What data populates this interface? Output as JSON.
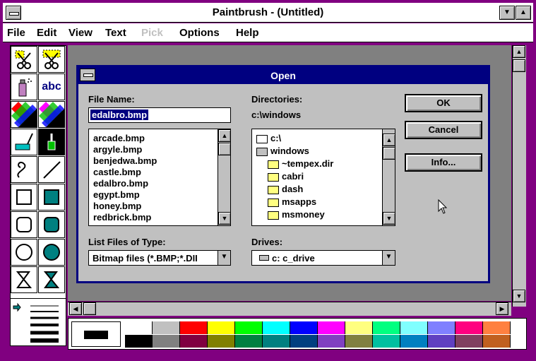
{
  "window": {
    "title": "Paintbrush - (Untitled)"
  },
  "menu": [
    "File",
    "Edit",
    "View",
    "Text",
    "Pick",
    "Options",
    "Help"
  ],
  "menu_disabled": [
    "Pick"
  ],
  "dialog": {
    "title": "Open",
    "file_name_label": "File Name:",
    "file_name_value": "edalbro.bmp",
    "directories_label": "Directories:",
    "current_dir": "c:\\windows",
    "files": [
      "arcade.bmp",
      "argyle.bmp",
      "benjedwa.bmp",
      "castle.bmp",
      "edalbro.bmp",
      "egypt.bmp",
      "honey.bmp",
      "redbrick.bmp"
    ],
    "dirs": [
      "c:\\",
      "windows",
      "~tempex.dir",
      "cabri",
      "dash",
      "msapps",
      "msmoney"
    ],
    "list_type_label": "List Files of Type:",
    "list_type_value": "Bitmap files (*.BMP;*.DII",
    "drives_label": "Drives:",
    "drive_value": "c: c_drive",
    "ok_label": "OK",
    "cancel_label": "Cancel",
    "info_label": "Info..."
  },
  "tools": [
    "scissors-pick",
    "scissors-net",
    "spray-can",
    "text-tool",
    "color-eraser",
    "eraser",
    "paint-roller",
    "brush",
    "curve",
    "line",
    "box",
    "filled-box",
    "rounded-box",
    "filled-rounded-box",
    "circle",
    "filled-circle",
    "polygon",
    "filled-polygon"
  ],
  "palette_top": [
    "#ffffff",
    "#c0c0c0",
    "#ff0000",
    "#ffff00",
    "#00ff00",
    "#00ffff",
    "#0000ff",
    "#ff00ff",
    "#ffff80",
    "#00ff80",
    "#80ffff",
    "#8080ff",
    "#ff0080",
    "#ff8040"
  ],
  "palette_bottom": [
    "#000000",
    "#808080",
    "#800040",
    "#808000",
    "#008040",
    "#008080",
    "#004080",
    "#8040c0",
    "#808040",
    "#00c0a0",
    "#0080c0",
    "#6040c0",
    "#804060",
    "#c06020"
  ],
  "selected_color": "#000000"
}
